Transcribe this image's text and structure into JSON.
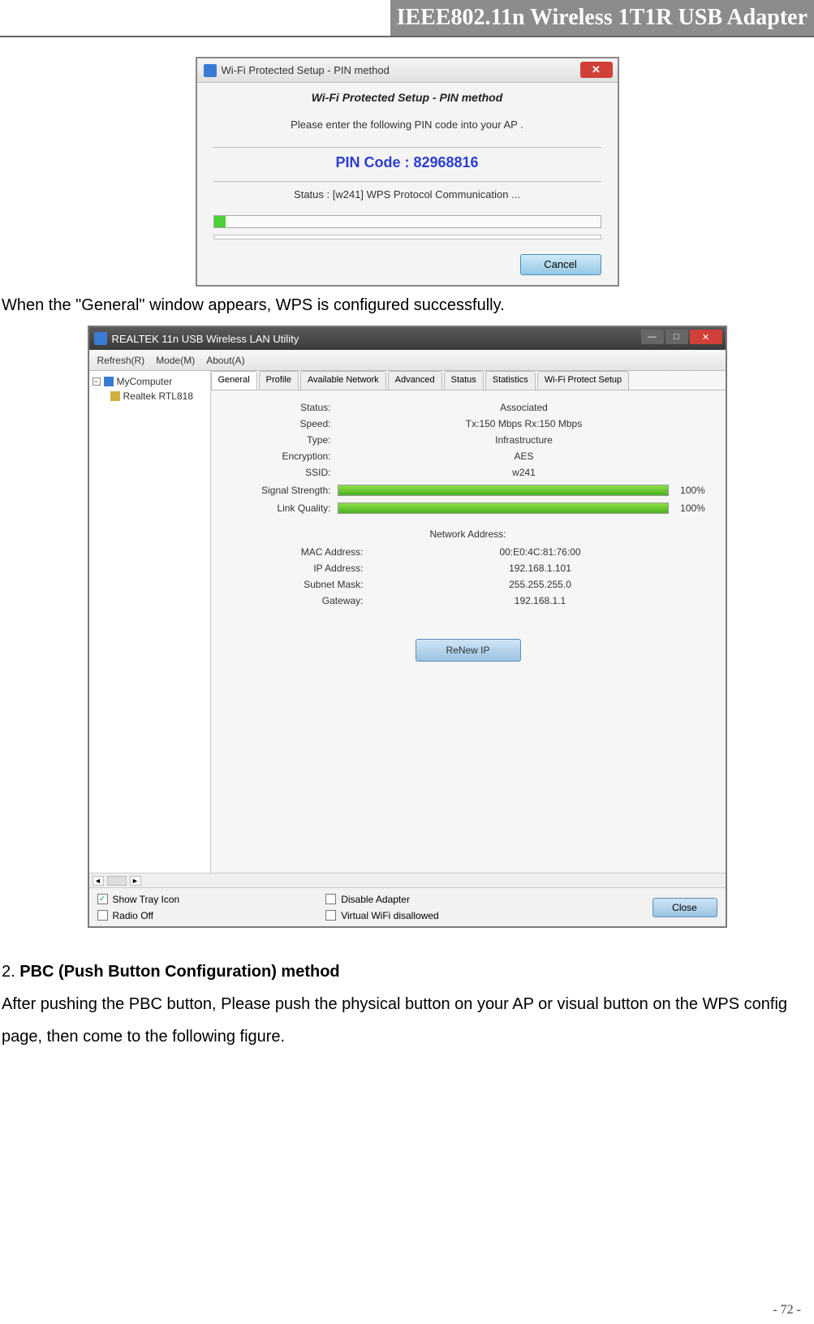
{
  "header": {
    "title": "IEEE802.11n Wireless 1T1R USB Adapter"
  },
  "page_number": "- 72 -",
  "dlg1": {
    "title": "Wi-Fi Protected Setup - PIN method",
    "subtitle": "Wi-Fi Protected Setup - PIN method",
    "instruction": "Please enter the following PIN code into your AP .",
    "pin_label": "PIN Code :  82968816",
    "status": "Status : [w241] WPS Protocol Communication ...",
    "cancel": "Cancel",
    "close_glyph": "✕"
  },
  "para1": "When the \"General\" window appears, WPS is configured successfully.",
  "dlg2": {
    "title": "REALTEK 11n USB Wireless LAN Utility",
    "menus": [
      "Refresh(R)",
      "Mode(M)",
      "About(A)"
    ],
    "tree": {
      "root": "MyComputer",
      "child": "Realtek RTL818"
    },
    "tabs": [
      "General",
      "Profile",
      "Available Network",
      "Advanced",
      "Status",
      "Statistics",
      "Wi-Fi Protect Setup"
    ],
    "status": {
      "Status": "Associated",
      "Speed": "Tx:150 Mbps Rx:150 Mbps",
      "Type": "Infrastructure",
      "Encryption": "AES",
      "SSID": "w241"
    },
    "signal": {
      "label": "Signal Strength:",
      "pct": "100%"
    },
    "link": {
      "label": "Link Quality:",
      "pct": "100%"
    },
    "netaddr_label": "Network Address:",
    "netaddr": {
      "MAC Address": "00:E0:4C:81:76:00",
      "IP Address": "192.168.1.101",
      "Subnet Mask": "255.255.255.0",
      "Gateway": "192.168.1.1"
    },
    "renew": "ReNew IP",
    "bottom": {
      "show_tray": "Show Tray Icon",
      "radio_off": "Radio Off",
      "disable_adapter": "Disable Adapter",
      "vwifi": "Virtual WiFi disallowed",
      "close": "Close"
    },
    "winbtns": {
      "min": "—",
      "max": "□",
      "close": "✕"
    },
    "tree_toggle": "−",
    "scroll_left": "◄",
    "scroll_right": "►",
    "check_mark": "✓"
  },
  "para2": {
    "lead": "2. ",
    "bold": "PBC (Push Button Configuration) method",
    "rest": "After pushing the PBC button, Please push the physical button on your AP or visual button on the WPS config page, then come to the following figure."
  }
}
